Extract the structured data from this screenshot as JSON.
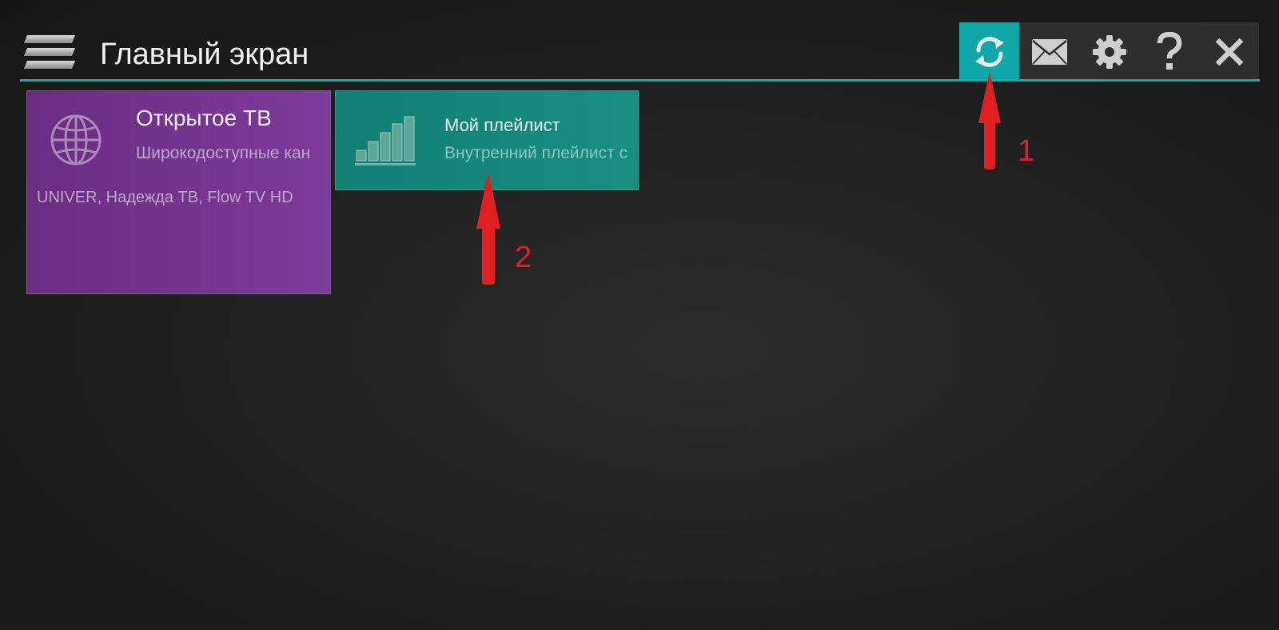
{
  "header": {
    "title": "Главный экран",
    "menu_icon": "hamburger-menu-icon",
    "accent_color": "#1aa9a6"
  },
  "toolbar": {
    "buttons": [
      {
        "icon": "refresh-icon",
        "active": true
      },
      {
        "icon": "mail-icon",
        "active": false
      },
      {
        "icon": "gear-icon",
        "active": false
      },
      {
        "icon": "help-icon",
        "active": false
      },
      {
        "icon": "close-icon",
        "active": false
      }
    ],
    "active_color": "#0fa6a8"
  },
  "tiles": [
    {
      "title": "Открытое ТВ",
      "subtitle": "Широкодоступные кан",
      "channels": "UNIVER, Надежда ТВ, Flow TV HD",
      "icon": "globe-icon",
      "color": "#7a3894"
    },
    {
      "title": "Мой плейлист",
      "subtitle": "Внутренний плейлист с",
      "icon": "signal-bars-icon",
      "color": "#158a7d"
    }
  ],
  "annotations": {
    "label_1": "1",
    "label_2": "2",
    "color": "#e02020"
  }
}
